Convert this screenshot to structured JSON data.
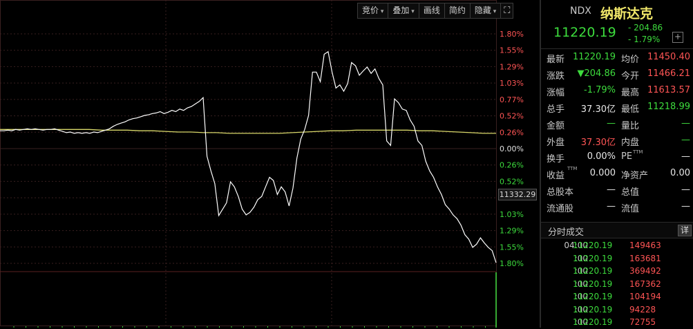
{
  "toolbar": {
    "items": [
      {
        "label": "竞价",
        "caret": true
      },
      {
        "label": "叠加",
        "caret": true
      },
      {
        "label": "画线",
        "caret": false
      },
      {
        "label": "简约",
        "caret": false
      },
      {
        "label": "隐藏",
        "caret": true
      }
    ],
    "fullscreen_icon": "expand-icon"
  },
  "chart_data": {
    "type": "line",
    "y_pct_labels_up": [
      "1.80%",
      "1.55%",
      "1.29%",
      "1.03%",
      "0.77%",
      "0.52%",
      "0.26%"
    ],
    "zero_label": "0.00%",
    "y_pct_labels_down": [
      "0.26%",
      "0.52%",
      "0.77%",
      "1.03%",
      "1.29%",
      "1.55%",
      "1.80%"
    ],
    "ylim_pct": [
      -1.8,
      1.8
    ],
    "current_price_tag": "11332.29",
    "colors": {
      "price_line": "#ffffff",
      "avg_line": "#d8d86a",
      "up": "#ff5555",
      "down": "#3ddc3d",
      "grid": "#3a2020",
      "volume": "#3ddc3d"
    },
    "price_pct": [
      0.28,
      0.28,
      0.29,
      0.28,
      0.3,
      0.29,
      0.3,
      0.31,
      0.3,
      0.31,
      0.3,
      0.29,
      0.3,
      0.3,
      0.31,
      0.29,
      0.27,
      0.25,
      0.26,
      0.24,
      0.25,
      0.24,
      0.25,
      0.24,
      0.26,
      0.25,
      0.27,
      0.29,
      0.31,
      0.35,
      0.38,
      0.4,
      0.42,
      0.45,
      0.47,
      0.48,
      0.5,
      0.52,
      0.53,
      0.55,
      0.56,
      0.58,
      0.55,
      0.57,
      0.6,
      0.58,
      0.62,
      0.6,
      0.64,
      0.66,
      0.7,
      0.74,
      0.8,
      -0.12,
      -0.35,
      -0.55,
      -1.05,
      -0.95,
      -0.85,
      -0.52,
      -0.6,
      -0.75,
      -0.95,
      -1.04,
      -1.0,
      -0.92,
      -0.8,
      -0.75,
      -0.6,
      -0.45,
      -0.5,
      -0.72,
      -0.6,
      -0.68,
      -0.9,
      -0.62,
      -0.15,
      0.15,
      0.3,
      0.52,
      1.2,
      1.2,
      1.05,
      1.48,
      1.52,
      1.2,
      0.95,
      1.0,
      0.9,
      1.02,
      1.35,
      1.3,
      1.15,
      1.22,
      1.28,
      1.18,
      1.25,
      1.1,
      1.0,
      0.12,
      0.05,
      0.78,
      0.72,
      0.62,
      0.6,
      0.45,
      0.35,
      0.12,
      0.05,
      -0.2,
      -0.35,
      -0.45,
      -0.6,
      -0.72,
      -0.88,
      -0.95,
      -1.04,
      -1.1,
      -1.2,
      -1.35,
      -1.42,
      -1.55,
      -1.5,
      -1.4,
      -1.48,
      -1.55,
      -1.6,
      -1.79
    ],
    "avg_pct": [
      0.3,
      0.3,
      0.3,
      0.3,
      0.3,
      0.3,
      0.3,
      0.3,
      0.29,
      0.29,
      0.29,
      0.28,
      0.28,
      0.27,
      0.26,
      0.26,
      0.25,
      0.25,
      0.24,
      0.24,
      0.24,
      0.24,
      0.24,
      0.25,
      0.26,
      0.27,
      0.28,
      0.28,
      0.29,
      0.29,
      0.29,
      0.29,
      0.29,
      0.28,
      0.28,
      0.27,
      0.26,
      0.25,
      0.24,
      0.24
    ],
    "volume_last": 1.0
  },
  "quote": {
    "code": "NDX",
    "name": "纳斯达克",
    "last": "11220.19",
    "change": "- 204.86",
    "change_pct": "- 1.79%",
    "add_icon": "plus-icon",
    "rows": [
      {
        "l1": "最新",
        "v1": "11220.19",
        "c1": "green",
        "l2": "均价",
        "v2": "11450.40",
        "c2": "red"
      },
      {
        "l1": "涨跌",
        "v1": "▼204.86",
        "c1": "green",
        "l2": "今开",
        "v2": "11466.21",
        "c2": "red"
      },
      {
        "l1": "涨幅",
        "v1": "-1.79%",
        "c1": "green",
        "l2": "最高",
        "v2": "11613.57",
        "c2": "red"
      },
      {
        "l1": "总手",
        "v1": "37.30亿",
        "c1": "white",
        "l2": "最低",
        "v2": "11218.99",
        "c2": "green"
      },
      {
        "l1": "金额",
        "v1": "—",
        "c1": "green",
        "l2": "量比",
        "v2": "—",
        "c2": "green"
      },
      {
        "l1": "外盘",
        "v1": "37.30亿",
        "c1": "red",
        "l2": "内盘",
        "v2": "—",
        "c2": "green"
      },
      {
        "l1": "换手",
        "v1": "0.00%",
        "c1": "white",
        "l2": "PE",
        "l2sup": "TTM",
        "v2": "—",
        "c2": "white"
      },
      {
        "l1": "收益",
        "l1sup": "TTM",
        "v1": "0.000",
        "c1": "white",
        "l2": "净资产",
        "v2": "0.00",
        "c2": "white"
      },
      {
        "l1": "总股本",
        "v1": "—",
        "c1": "white",
        "l2": "总值",
        "v2": "—",
        "c2": "white"
      },
      {
        "l1": "流通股",
        "v1": "—",
        "c1": "white",
        "l2": "流值",
        "v2": "—",
        "c2": "white"
      }
    ]
  },
  "ticks": {
    "title": "分时成交",
    "detail_label": "详",
    "rows": [
      {
        "time": "04:00",
        "price": "11220.19",
        "vol": "149463"
      },
      {
        "time": ":00",
        "price": "11220.19",
        "vol": "163681"
      },
      {
        "time": ":00",
        "price": "11220.19",
        "vol": "369492"
      },
      {
        "time": ":00",
        "price": "11220.19",
        "vol": "167362"
      },
      {
        "time": ":00",
        "price": "11220.19",
        "vol": "104194"
      },
      {
        "time": ":00",
        "price": "11220.19",
        "vol": "94228"
      },
      {
        "time": ":00",
        "price": "11220.19",
        "vol": "72755"
      }
    ]
  }
}
